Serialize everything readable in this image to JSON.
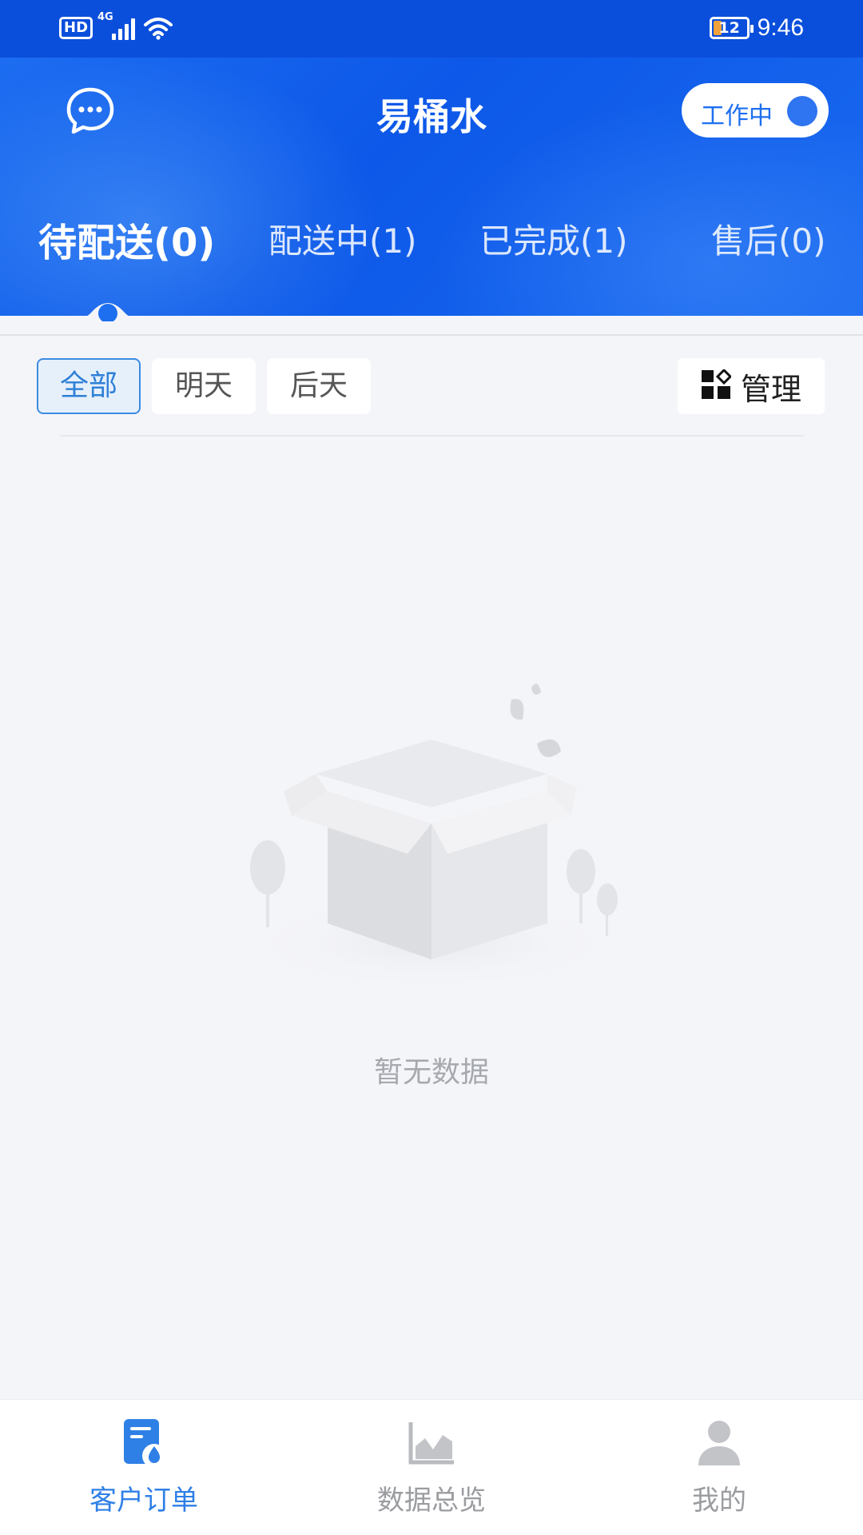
{
  "status_bar": {
    "hd": "HD",
    "network": "4G",
    "battery_level": "12",
    "time": "9:46"
  },
  "header": {
    "title": "易桶水",
    "work_status_label": "工作中",
    "message_icon": "chat-bubble-icon"
  },
  "tabs": [
    {
      "label": "待配送(0)",
      "active": true
    },
    {
      "label": "配送中(1)",
      "active": false
    },
    {
      "label": "已完成(1)",
      "active": false
    },
    {
      "label": "售后(0)",
      "active": false
    }
  ],
  "filters": [
    {
      "label": "全部",
      "active": true
    },
    {
      "label": "明天",
      "active": false
    },
    {
      "label": "后天",
      "active": false
    }
  ],
  "manage": {
    "label": "管理",
    "icon": "grid-manage-icon"
  },
  "empty_state": {
    "text": "暂无数据",
    "icon": "empty-box-icon"
  },
  "bottom_nav": [
    {
      "label": "客户订单",
      "icon": "order-icon",
      "active": true
    },
    {
      "label": "数据总览",
      "icon": "chart-icon",
      "active": false
    },
    {
      "label": "我的",
      "icon": "user-icon",
      "active": false
    }
  ],
  "colors": {
    "primary": "#1e6ff0",
    "header_dark": "#0a4fdc",
    "background": "#f4f5f9",
    "muted_text": "#a6a9ae",
    "battery_low": "#f2a23a"
  }
}
